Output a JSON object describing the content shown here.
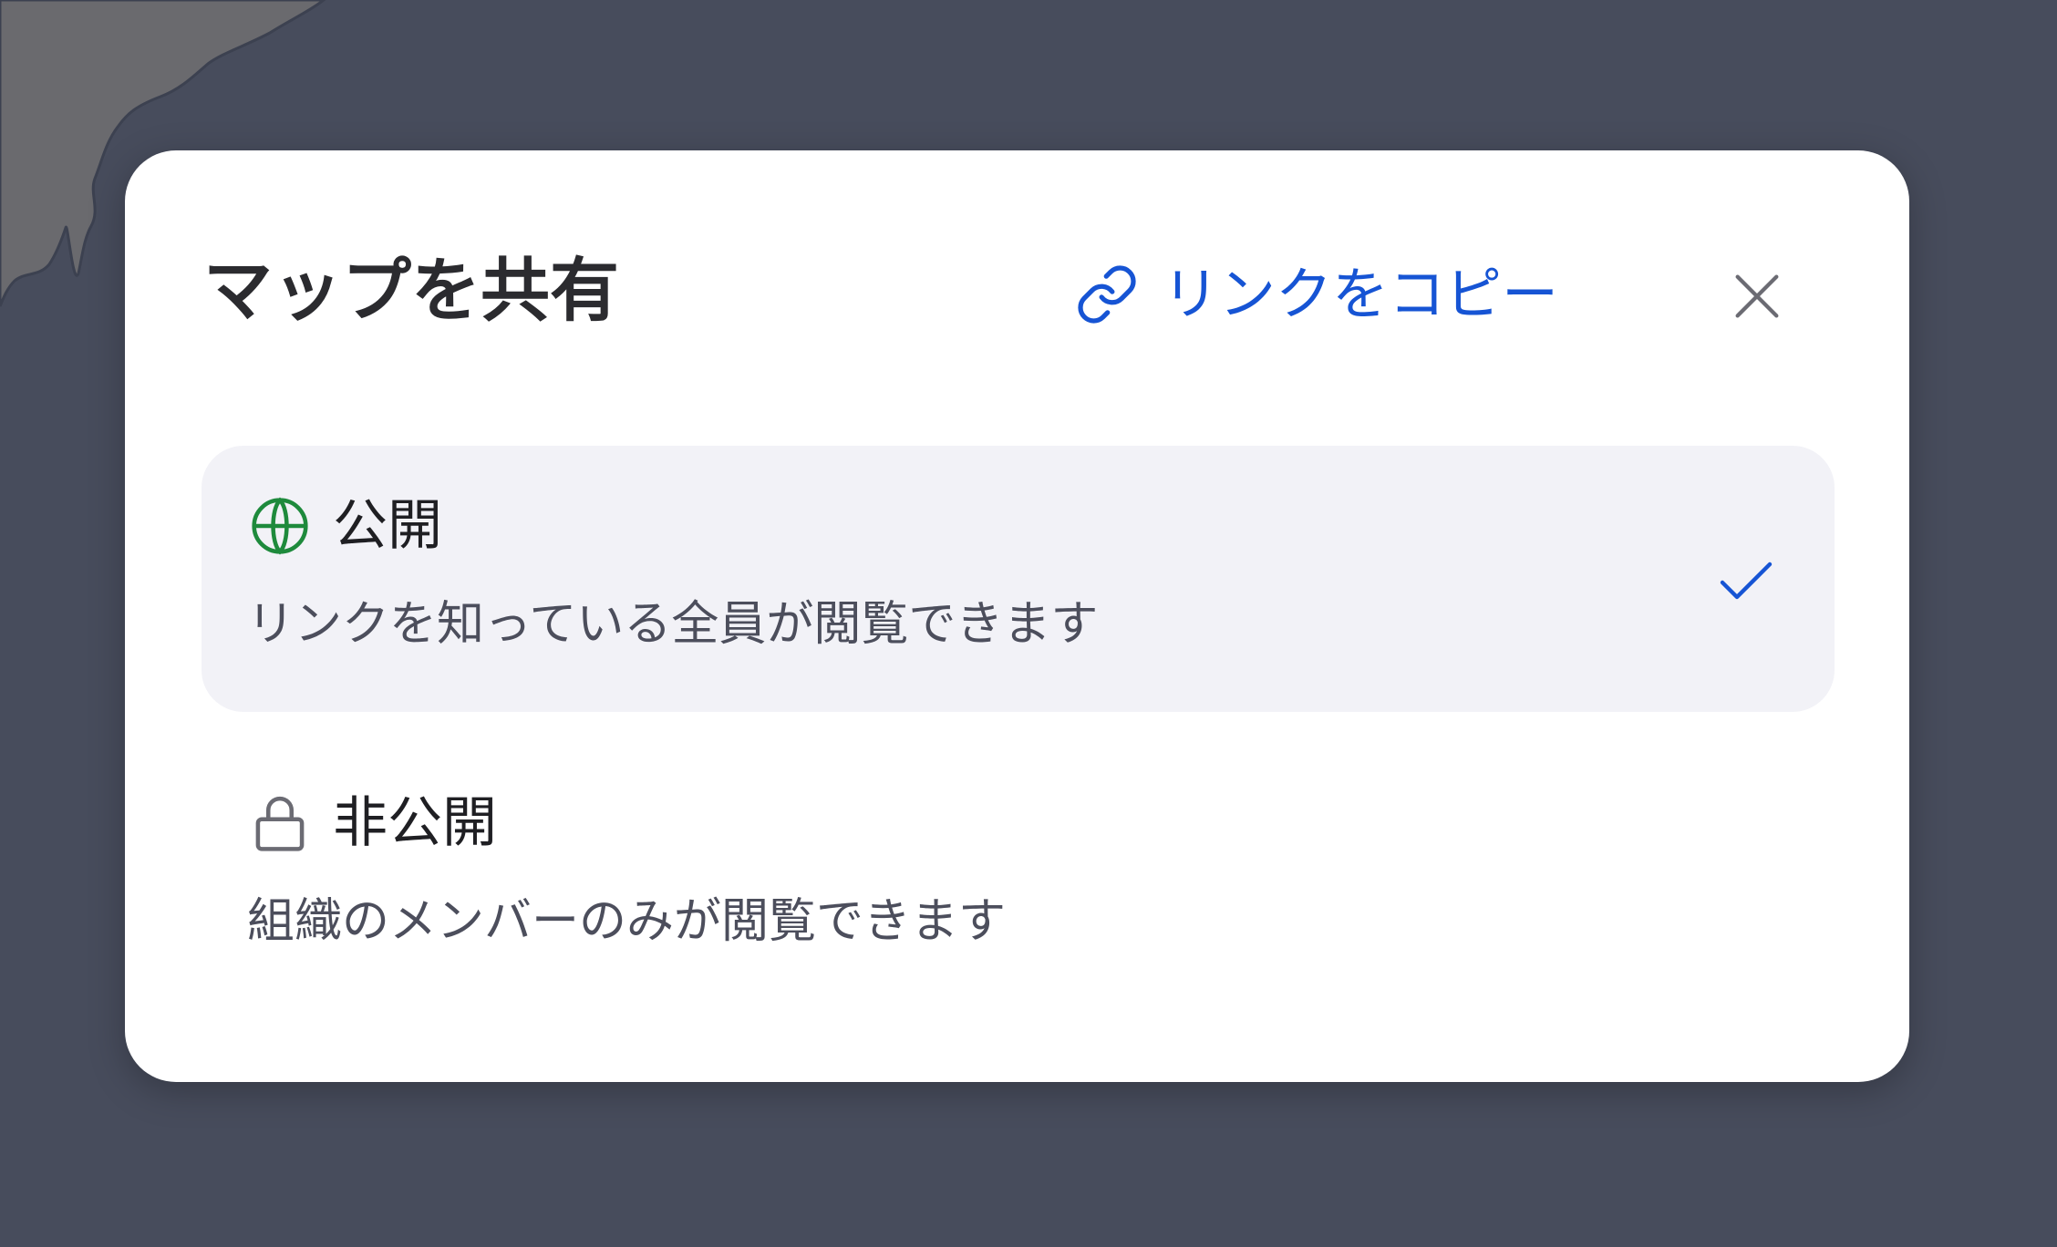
{
  "dialog": {
    "title": "マップを共有",
    "copy_link_label": "リンクをコピー",
    "close_label": "×"
  },
  "options": [
    {
      "name": "公開",
      "description": "リンクを知っている全員が閲覧できます",
      "icon": "globe-icon",
      "selected": true
    },
    {
      "name": "非公開",
      "description": "組織のメンバーのみが閲覧できます",
      "icon": "lock-icon",
      "selected": false
    }
  ],
  "colors": {
    "backdrop": "#474c5c",
    "land": "#6a6a6e",
    "dialog_bg": "#ffffff",
    "accent_blue": "#1654d4",
    "globe_green": "#1e8a3c",
    "selected_bg": "#f2f2f7",
    "title_text": "#2b2b2f",
    "desc_text": "#4c4e5c"
  }
}
